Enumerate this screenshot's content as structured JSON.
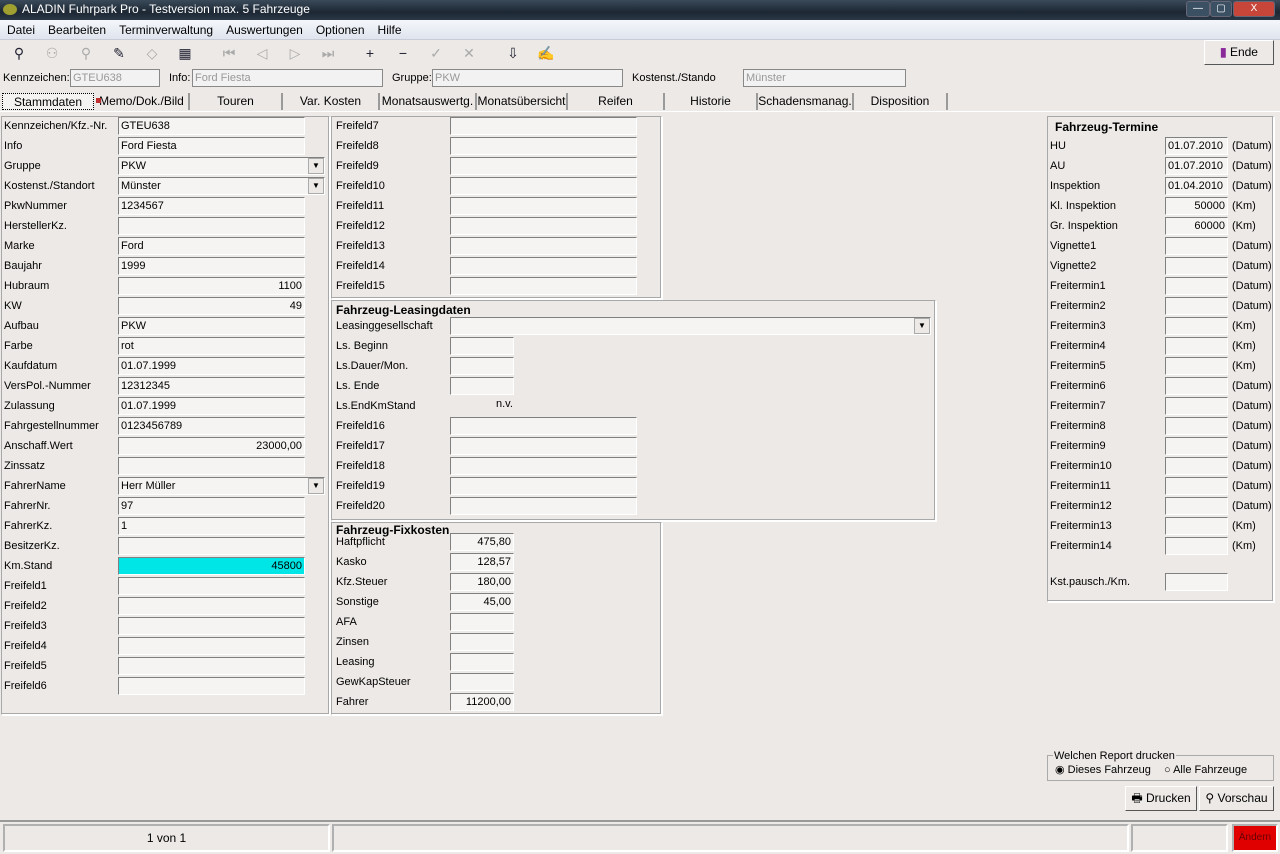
{
  "window": {
    "title": "ALADIN Fuhrpark Pro - Testversion  max. 5 Fahrzeuge",
    "min": "—",
    "max": "▢",
    "close": "X"
  },
  "menu": [
    "Datei",
    "Bearbeiten",
    "Terminverwaltung",
    "Auswertungen",
    "Optionen",
    "Hilfe"
  ],
  "toolbar": {
    "icons": [
      "search-icon",
      "find-group-icon",
      "zoom-icon",
      "new-vehicle-icon",
      "erase-icon",
      "calendar-icon",
      "first-icon",
      "prev-icon",
      "next-icon",
      "last-icon",
      "add-icon",
      "remove-icon",
      "confirm-icon",
      "cancel-icon",
      "import-icon",
      "edit-icon"
    ],
    "glyphs": [
      "⚲",
      "⚇",
      "⚲",
      "✎",
      "◇",
      "▦",
      "⏮",
      "◁",
      "▷",
      "⏭",
      "+",
      "−",
      "✓",
      "✕",
      "⇩",
      "✍"
    ],
    "ende": "Ende"
  },
  "header": {
    "kennzeichen_label": "Kennzeichen:",
    "kennzeichen": "GTEU638",
    "info_label": "Info:",
    "info": "Ford Fiesta",
    "gruppe_label": "Gruppe:",
    "gruppe": "PKW",
    "kostenst_label": "Kostenst./Stando",
    "kostenst": "Münster"
  },
  "tabs": [
    "Stammdaten",
    "Memo/Dok./Bild",
    "Touren",
    "Var. Kosten",
    "Monatsauswertg.",
    "Monatsübersicht",
    "Reifen",
    "Historie",
    "Schadensmanag.",
    "Disposition"
  ],
  "stamm": [
    {
      "label": "Kennzeichen/Kfz.-Nr.",
      "value": "GTEU638"
    },
    {
      "label": "Info",
      "value": "Ford Fiesta"
    },
    {
      "label": "Gruppe",
      "value": "PKW",
      "combo": true
    },
    {
      "label": "Kostenst./Standort",
      "value": "Münster",
      "combo": true
    },
    {
      "label": "PkwNummer",
      "value": "1234567"
    },
    {
      "label": "HerstellerKz.",
      "value": ""
    },
    {
      "label": "Marke",
      "value": "Ford"
    },
    {
      "label": "Baujahr",
      "value": "1999"
    },
    {
      "label": "Hubraum",
      "value": "1100",
      "right": true
    },
    {
      "label": "KW",
      "value": "49",
      "right": true
    },
    {
      "label": "Aufbau",
      "value": "PKW"
    },
    {
      "label": "Farbe",
      "value": "rot"
    },
    {
      "label": "Kaufdatum",
      "value": "01.07.1999"
    },
    {
      "label": "VersPol.-Nummer",
      "value": "12312345"
    },
    {
      "label": "Zulassung",
      "value": "01.07.1999"
    },
    {
      "label": "Fahrgestellnummer",
      "value": "0123456789"
    },
    {
      "label": "Anschaff.Wert",
      "value": "23000,00",
      "right": true
    },
    {
      "label": "Zinssatz",
      "value": ""
    },
    {
      "label": "FahrerName",
      "value": "Herr Müller",
      "combo": true
    },
    {
      "label": "FahrerNr.",
      "value": "97"
    },
    {
      "label": "FahrerKz.",
      "value": "1"
    },
    {
      "label": "BesitzerKz.",
      "value": ""
    },
    {
      "label": "Km.Stand",
      "value": "45800",
      "right": true,
      "highlight": true
    },
    {
      "label": "Freifeld1",
      "value": ""
    },
    {
      "label": "Freifeld2",
      "value": ""
    },
    {
      "label": "Freifeld3",
      "value": ""
    },
    {
      "label": "Freifeld4",
      "value": ""
    },
    {
      "label": "Freifeld5",
      "value": ""
    },
    {
      "label": "Freifeld6",
      "value": ""
    }
  ],
  "frei_top": [
    {
      "label": "Freifeld7",
      "value": ""
    },
    {
      "label": "Freifeld8",
      "value": ""
    },
    {
      "label": "Freifeld9",
      "value": ""
    },
    {
      "label": "Freifeld10",
      "value": ""
    },
    {
      "label": "Freifeld11",
      "value": ""
    },
    {
      "label": "Freifeld12",
      "value": ""
    },
    {
      "label": "Freifeld13",
      "value": ""
    },
    {
      "label": "Freifeld14",
      "value": ""
    },
    {
      "label": "Freifeld15",
      "value": ""
    }
  ],
  "leasing": {
    "title": "Fahrzeug-Leasingdaten",
    "gesellschaft_label": "Leasinggesellschaft",
    "gesellschaft": "",
    "short": [
      {
        "label": "Ls. Beginn",
        "value": ""
      },
      {
        "label": "Ls.Dauer/Mon.",
        "value": ""
      },
      {
        "label": "Ls. Ende",
        "value": ""
      }
    ],
    "endkm_label": "Ls.EndKmStand",
    "endkm": "n.v.",
    "frei": [
      {
        "label": "Freifeld16",
        "value": ""
      },
      {
        "label": "Freifeld17",
        "value": ""
      },
      {
        "label": "Freifeld18",
        "value": ""
      },
      {
        "label": "Freifeld19",
        "value": ""
      },
      {
        "label": "Freifeld20",
        "value": ""
      }
    ]
  },
  "fixkosten": {
    "title": "Fahrzeug-Fixkosten",
    "rows": [
      {
        "label": "Haftpflicht",
        "value": "475,80"
      },
      {
        "label": "Kasko",
        "value": "128,57"
      },
      {
        "label": "Kfz.Steuer",
        "value": "180,00"
      },
      {
        "label": "Sonstige",
        "value": "45,00"
      },
      {
        "label": "AFA",
        "value": ""
      },
      {
        "label": "Zinsen",
        "value": ""
      },
      {
        "label": "Leasing",
        "value": ""
      },
      {
        "label": "GewKapSteuer",
        "value": ""
      },
      {
        "label": "Fahrer",
        "value": "11200,00"
      }
    ]
  },
  "termine": {
    "title": "Fahrzeug-Termine",
    "rows": [
      {
        "label": "HU",
        "value": "01.07.2010",
        "unit": "(Datum)"
      },
      {
        "label": "AU",
        "value": "01.07.2010",
        "unit": "(Datum)"
      },
      {
        "label": "Inspektion",
        "value": "01.04.2010",
        "unit": "(Datum)"
      },
      {
        "label": "Kl. Inspektion",
        "value": "50000",
        "unit": "(Km)",
        "right": true
      },
      {
        "label": "Gr. Inspektion",
        "value": "60000",
        "unit": "(Km)",
        "right": true
      },
      {
        "label": "Vignette1",
        "value": "",
        "unit": "(Datum)"
      },
      {
        "label": "Vignette2",
        "value": "",
        "unit": "(Datum)"
      },
      {
        "label": "Freitermin1",
        "value": "",
        "unit": "(Datum)"
      },
      {
        "label": "Freitermin2",
        "value": "",
        "unit": "(Datum)"
      },
      {
        "label": "Freitermin3",
        "value": "",
        "unit": "(Km)"
      },
      {
        "label": "Freitermin4",
        "value": "",
        "unit": "(Km)"
      },
      {
        "label": "Freitermin5",
        "value": "",
        "unit": "(Km)"
      },
      {
        "label": "Freitermin6",
        "value": "",
        "unit": "(Datum)"
      },
      {
        "label": "Freitermin7",
        "value": "",
        "unit": "(Datum)"
      },
      {
        "label": "Freitermin8",
        "value": "",
        "unit": "(Datum)"
      },
      {
        "label": "Freitermin9",
        "value": "",
        "unit": "(Datum)"
      },
      {
        "label": "Freitermin10",
        "value": "",
        "unit": "(Datum)"
      },
      {
        "label": "Freitermin11",
        "value": "",
        "unit": "(Datum)"
      },
      {
        "label": "Freitermin12",
        "value": "",
        "unit": "(Datum)"
      },
      {
        "label": "Freitermin13",
        "value": "",
        "unit": "(Km)"
      },
      {
        "label": "Freitermin14",
        "value": "",
        "unit": "(Km)"
      }
    ],
    "kst_label": "Kst.pausch./Km.",
    "kst": ""
  },
  "report": {
    "title": "Welchen Report drucken",
    "opt1": "Dieses Fahrzeug",
    "opt2": "Alle Fahrzeuge",
    "drucken": "Drucken",
    "vorschau": "Vorschau"
  },
  "status": {
    "record": "1 von 1",
    "aendern": "Ändern"
  },
  "colors": {
    "highlight": "#00e5e5",
    "aendern": "#e00000"
  }
}
